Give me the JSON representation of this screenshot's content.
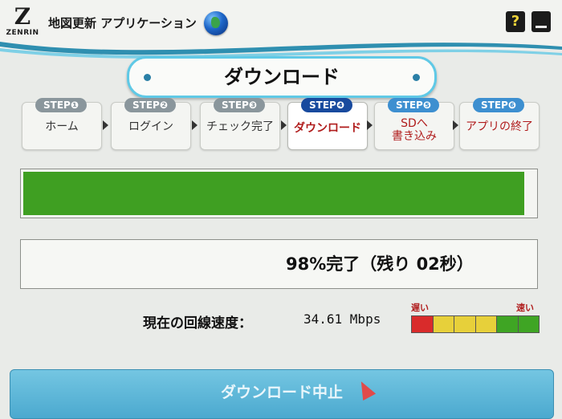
{
  "header": {
    "logo_letter": "Z",
    "logo_brand": "ZENRIN",
    "app_title": "地図更新 アプリケーション",
    "help_label": "?"
  },
  "page_title": "ダウンロード",
  "steps": [
    {
      "badge": "STEP❶",
      "label": "ホーム",
      "state": "done"
    },
    {
      "badge": "STEP❷",
      "label": "ログイン",
      "state": "done"
    },
    {
      "badge": "STEP❸",
      "label": "チェック完了",
      "state": "done"
    },
    {
      "badge": "STEP❹",
      "label": "ダウンロード",
      "state": "active"
    },
    {
      "badge": "STEP❺",
      "label": "SDへ\n書き込み",
      "state": "future"
    },
    {
      "badge": "STEP❻",
      "label": "アプリの終了",
      "state": "future"
    }
  ],
  "progress": {
    "percent": 98,
    "status_text": "98%完了（残り 02秒）"
  },
  "speed": {
    "label": "現在の回線速度：",
    "value": "34.61 Mbps",
    "slow_label": "遅い",
    "fast_label": "速い",
    "segments": [
      "#d92b2b",
      "#e7d03a",
      "#e7d03a",
      "#e7d03a",
      "#3fa524",
      "#3fa524"
    ]
  },
  "cancel_button": {
    "label": "ダウンロード中止"
  },
  "colors": {
    "accent": "#5fc9e6",
    "progress": "#3f9f22",
    "active_step": "#b01c1c"
  }
}
